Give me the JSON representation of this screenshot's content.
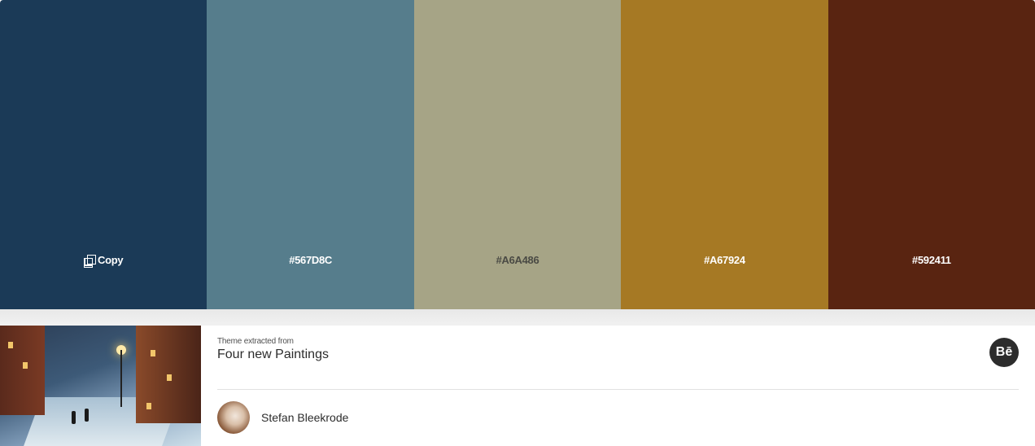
{
  "palette": {
    "swatches": [
      {
        "color": "#1B3A57",
        "label": "Copy",
        "label_color": "#FFFFFF",
        "icon": "copy-icon"
      },
      {
        "color": "#567D8C",
        "label": "#567D8C",
        "label_color": "#FFFFFF"
      },
      {
        "color": "#A6A486",
        "label": "#A6A486",
        "label_color": "#4A4A44"
      },
      {
        "color": "#A67924",
        "label": "#A67924",
        "label_color": "#FFFFFF"
      },
      {
        "color": "#592411",
        "label": "#592411",
        "label_color": "#FFFFFF"
      }
    ]
  },
  "source": {
    "extracted_label": "Theme extracted from",
    "project_title": "Four new Paintings",
    "platform_badge": "Bē",
    "platform_icon": "behance-icon",
    "author": {
      "name": "Stefan Bleekrode"
    }
  }
}
